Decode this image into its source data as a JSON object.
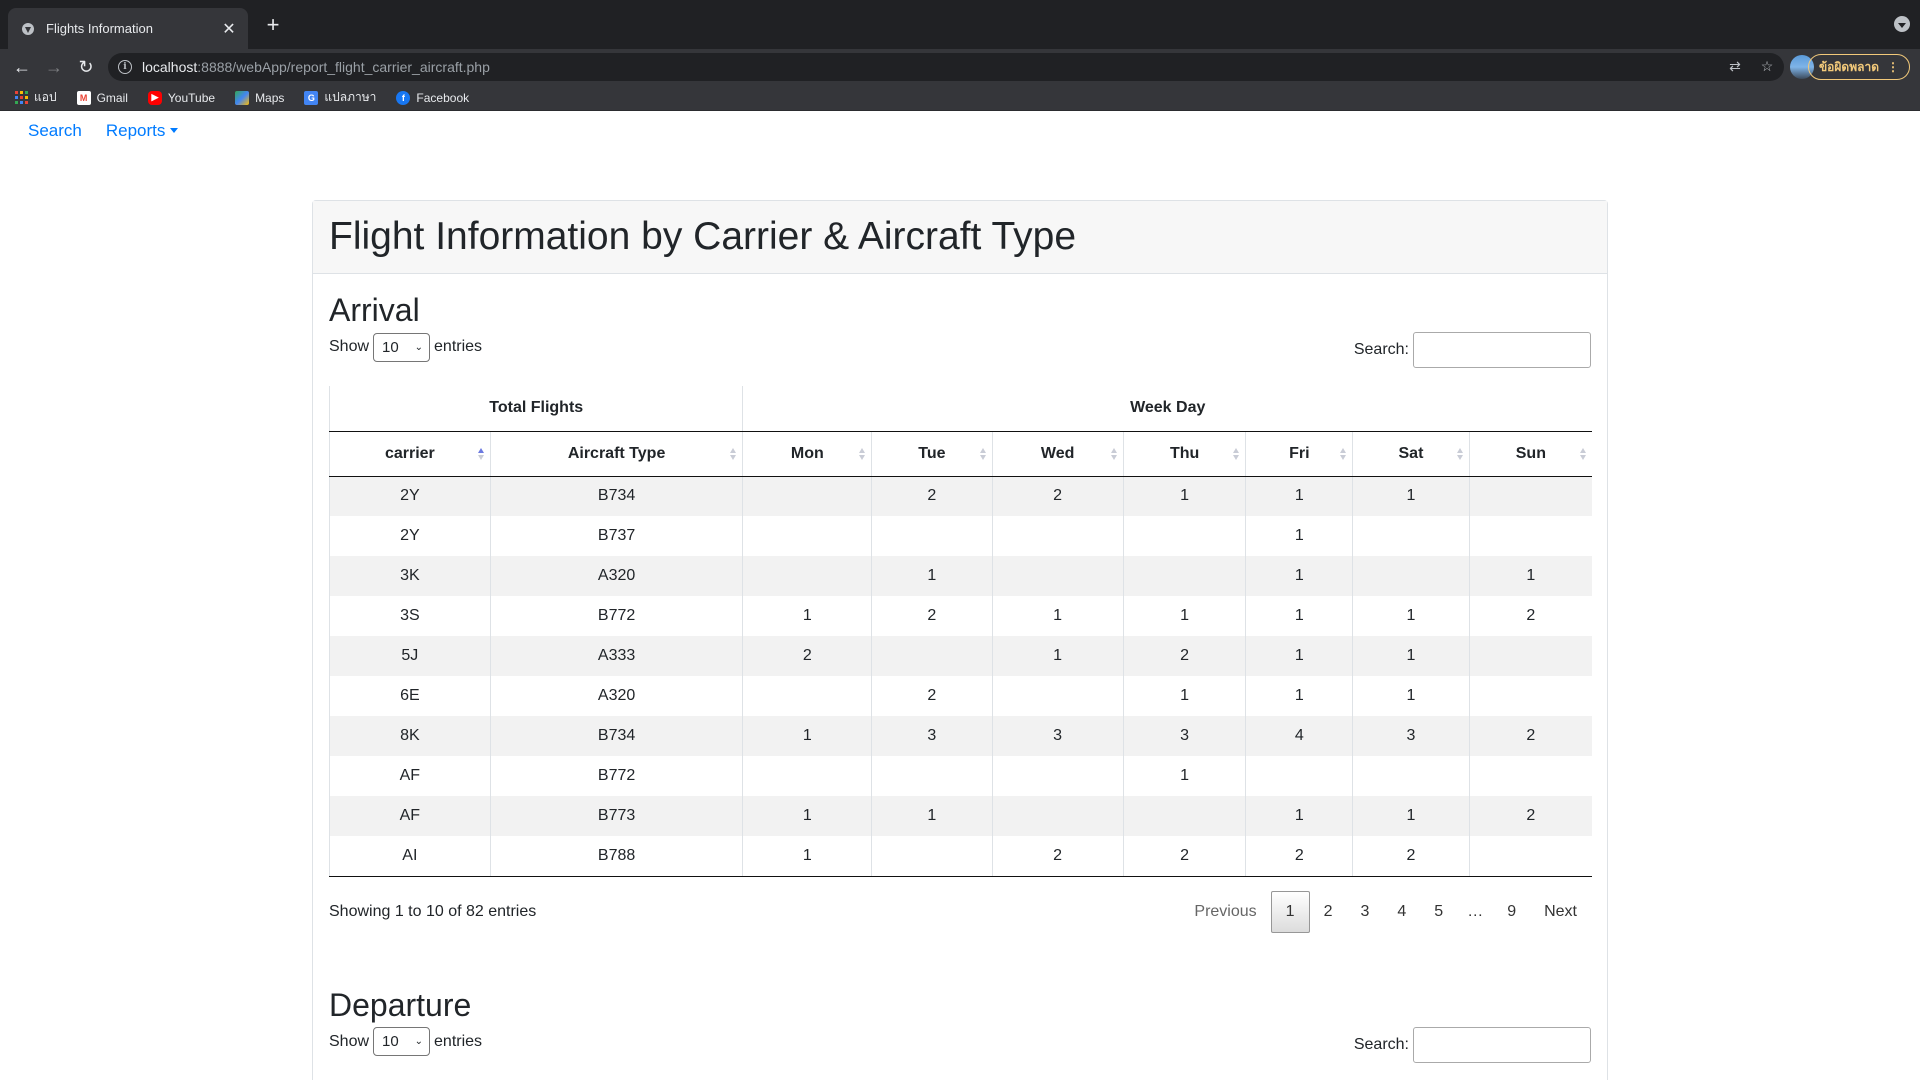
{
  "browser": {
    "tab_title": "Flights Information",
    "url_host": "localhost",
    "url_rest": ":8888/webApp/report_flight_carrier_aircraft.php",
    "update_label": "ข้อผิดพลาด",
    "bookmarks": [
      "แอป",
      "Gmail",
      "YouTube",
      "Maps",
      "แปลภาษา",
      "Facebook"
    ]
  },
  "nav": {
    "search": "Search",
    "reports": "Reports"
  },
  "page": {
    "title": "Flight Information by Carrier & Aircraft Type"
  },
  "arrival": {
    "heading": "Arrival",
    "show": "Show",
    "entries_value": "10",
    "entries": "entries",
    "search_label": "Search:",
    "group_headers": [
      "Total Flights",
      "Week Day"
    ],
    "columns": [
      "carrier",
      "Aircraft Type",
      "Mon",
      "Tue",
      "Wed",
      "Thu",
      "Fri",
      "Sat",
      "Sun"
    ],
    "rows": [
      [
        "2Y",
        "B734",
        "",
        "2",
        "2",
        "1",
        "1",
        "1",
        ""
      ],
      [
        "2Y",
        "B737",
        "",
        "",
        "",
        "",
        "1",
        "",
        ""
      ],
      [
        "3K",
        "A320",
        "",
        "1",
        "",
        "",
        "1",
        "",
        "1"
      ],
      [
        "3S",
        "B772",
        "1",
        "2",
        "1",
        "1",
        "1",
        "1",
        "2"
      ],
      [
        "5J",
        "A333",
        "2",
        "",
        "1",
        "2",
        "1",
        "1",
        ""
      ],
      [
        "6E",
        "A320",
        "",
        "2",
        "",
        "1",
        "1",
        "1",
        ""
      ],
      [
        "8K",
        "B734",
        "1",
        "3",
        "3",
        "3",
        "4",
        "3",
        "2"
      ],
      [
        "AF",
        "B772",
        "",
        "",
        "",
        "1",
        "",
        "",
        ""
      ],
      [
        "AF",
        "B773",
        "1",
        "1",
        "",
        "",
        "1",
        "1",
        "2"
      ],
      [
        "AI",
        "B788",
        "1",
        "",
        "2",
        "2",
        "2",
        "2",
        ""
      ]
    ],
    "info": "Showing 1 to 10 of 82 entries",
    "pager": {
      "previous": "Previous",
      "pages": [
        "1",
        "2",
        "3",
        "4",
        "5",
        "…",
        "9"
      ],
      "next": "Next"
    }
  },
  "departure": {
    "heading": "Departure",
    "show": "Show",
    "entries_value": "10",
    "entries": "entries",
    "search_label": "Search:"
  }
}
